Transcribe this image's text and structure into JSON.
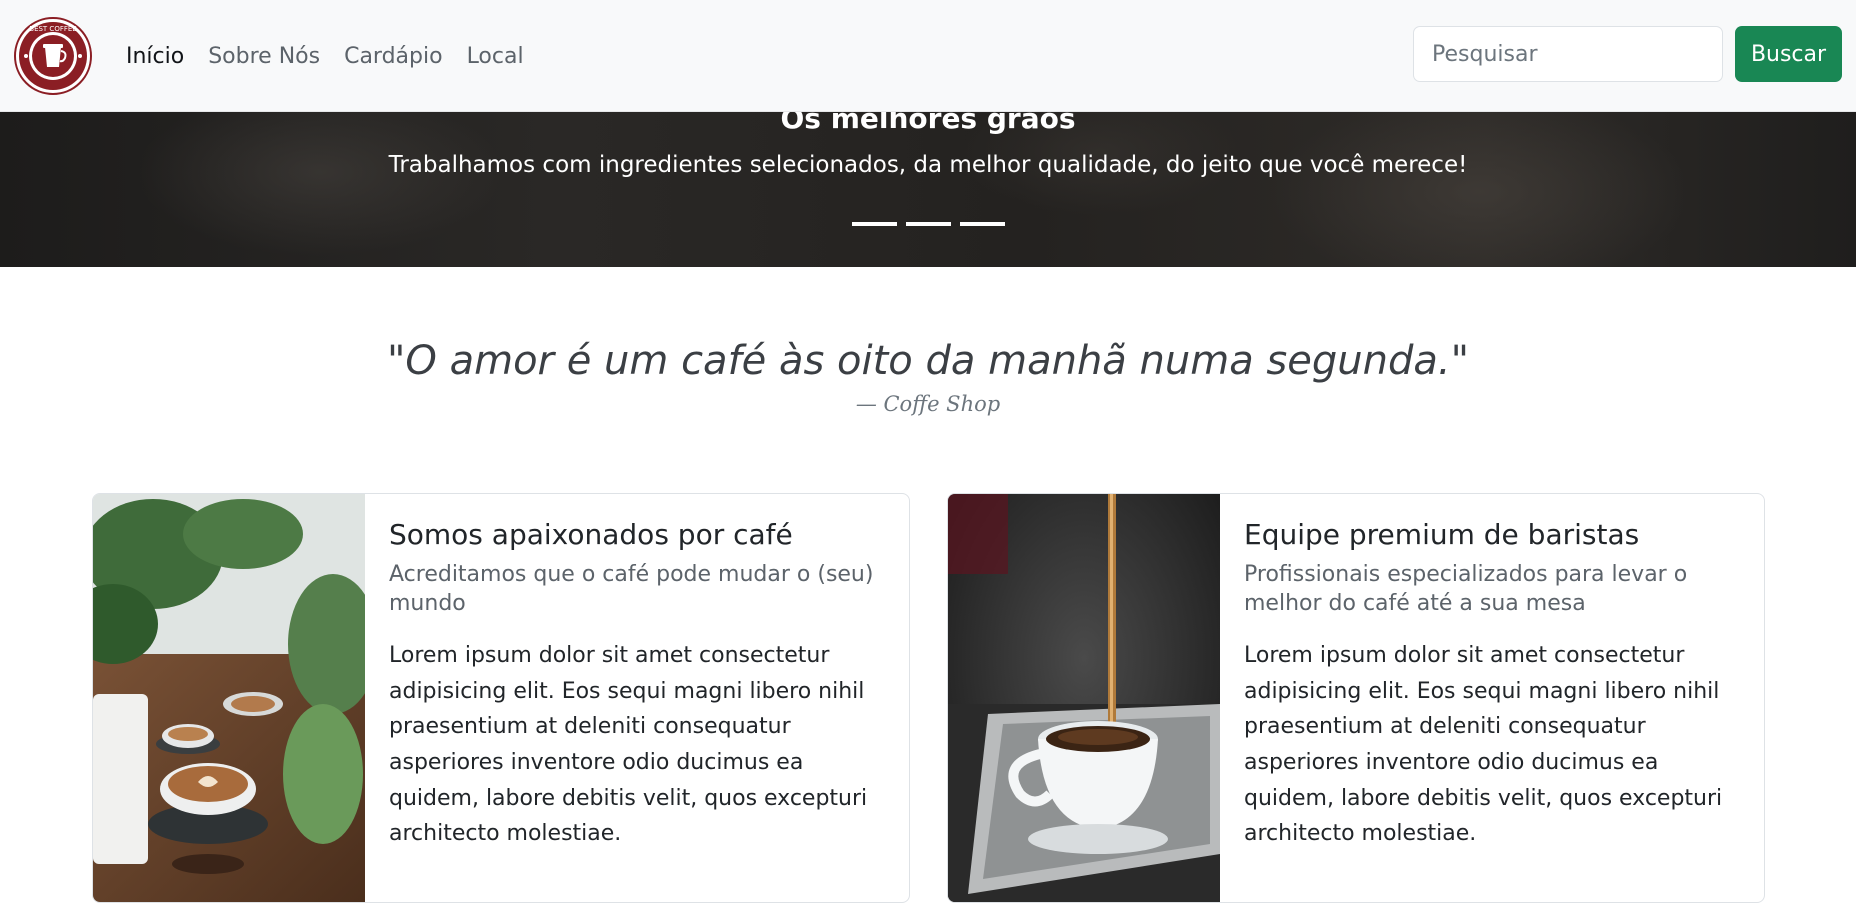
{
  "navbar": {
    "logo_text": "BEST COFFEE",
    "links": [
      {
        "label": "Início",
        "active": true
      },
      {
        "label": "Sobre Nós",
        "active": false
      },
      {
        "label": "Cardápio",
        "active": false
      },
      {
        "label": "Local",
        "active": false
      }
    ],
    "search": {
      "placeholder": "Pesquisar",
      "button_label": "Buscar"
    }
  },
  "hero": {
    "title": "Os melhores grãos",
    "text": "Trabalhamos com ingredientes selecionados, da melhor qualidade, do jeito que você merece!",
    "indicators": 3
  },
  "quote": {
    "text": "\"O amor é um café às oito da manhã numa segunda.\"",
    "author": "— Coffe Shop"
  },
  "cards": [
    {
      "title": "Somos apaixonados por café",
      "subtitle": "Acreditamos que o café pode mudar o (seu) mundo",
      "text": "Lorem ipsum dolor sit amet consectetur adipisicing elit. Eos sequi magni libero nihil praesentium at deleniti consequatur asperiores inventore odio ducimus ea quidem, labore debitis velit, quos excepturi architecto molestiae.",
      "image": "latte-cups-with-plants"
    },
    {
      "title": "Equipe premium de baristas",
      "subtitle": "Profissionais especializados para levar o melhor do café até a sua mesa",
      "text": "Lorem ipsum dolor sit amet consectetur adipisicing elit. Eos sequi magni libero nihil praesentium at deleniti consequatur asperiores inventore odio ducimus ea quidem, labore debitis velit, quos excepturi architecto molestiae.",
      "image": "coffee-pouring-into-cup"
    }
  ],
  "colors": {
    "navbar_bg": "#f8f9fa",
    "search_button": "#198754",
    "hero_bg": "#242220",
    "logo_red": "#8b1e24"
  }
}
